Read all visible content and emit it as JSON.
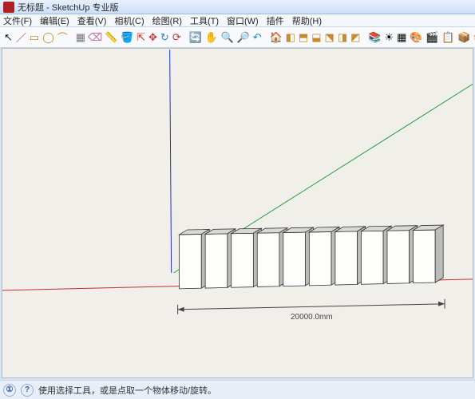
{
  "title_prefix": "无标题",
  "title_suffix": " - SketchUp 专业版",
  "menubar": {
    "file": "文件(F)",
    "edit": "编辑(E)",
    "view": "查看(V)",
    "camera": "相机(C)",
    "draw": "绘图(R)",
    "tools": "工具(T)",
    "window": "窗口(W)",
    "plugins": "插件",
    "help": "帮助(H)"
  },
  "toolbar": {
    "select": "↖",
    "line": "／",
    "rect": "▭",
    "circle": "◯",
    "arc": "⌒",
    "make": "▦",
    "eraser": "⌫",
    "tape": "📏",
    "paint": "🪣",
    "push": "⇱",
    "move": "✥",
    "rotate": "↻",
    "offset": "⟳",
    "orbit": "🔄",
    "pan": "✋",
    "zoom": "🔍",
    "zoomext": "🔎",
    "prev": "↶",
    "model": "🏠",
    "iso": "◧",
    "top": "⬒",
    "front": "⬓",
    "right": "⬔",
    "back": "◨",
    "left": "◩",
    "layers": "📚",
    "shadow": "☀",
    "xray": "▦",
    "styles": "🎨",
    "scenes": "🎬",
    "outliner": "📋",
    "components": "📦",
    "materials": "🎭"
  },
  "viewport": {
    "dimension_value": "20000.0mm",
    "box_count": 10
  },
  "statusbar": {
    "hint": "使用选择工具，或是点取一个物体移动/旋转。"
  }
}
